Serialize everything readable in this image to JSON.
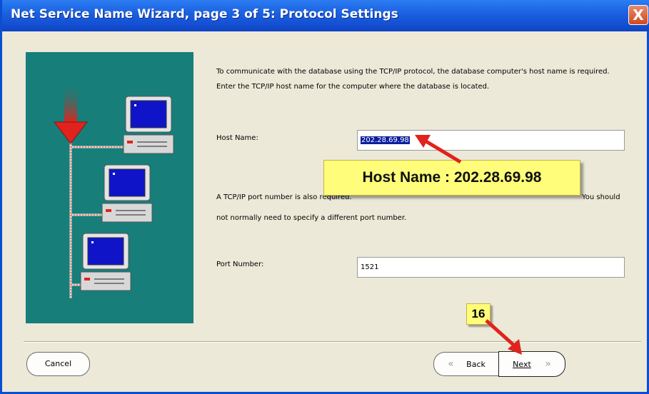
{
  "window": {
    "title": "Net Service Name Wizard, page 3 of 5: Protocol Settings",
    "close_glyph": "X"
  },
  "intro": {
    "line1": "To communicate with the database using the TCP/IP protocol, the database computer's host name is required.",
    "line2": "Enter the TCP/IP host name for the computer where the database is located."
  },
  "host": {
    "label": "Host Name:",
    "value": "202.28.69.98"
  },
  "port_info": {
    "line1_start": "A TCP/IP port number is also required.",
    "line1_end": "You should",
    "line2": "not normally need to specify a different port number."
  },
  "port": {
    "label": "Port Number:",
    "value": "1521"
  },
  "buttons": {
    "cancel": "Cancel",
    "back": "Back",
    "next": "Next"
  },
  "annotations": {
    "callout": "Host Name : 202.28.69.98",
    "step": "16"
  },
  "colors": {
    "title_bar": "#1653d6",
    "illustration_bg": "#177e7a",
    "callout_bg": "#fffd7a",
    "arrow": "#e0231c"
  }
}
